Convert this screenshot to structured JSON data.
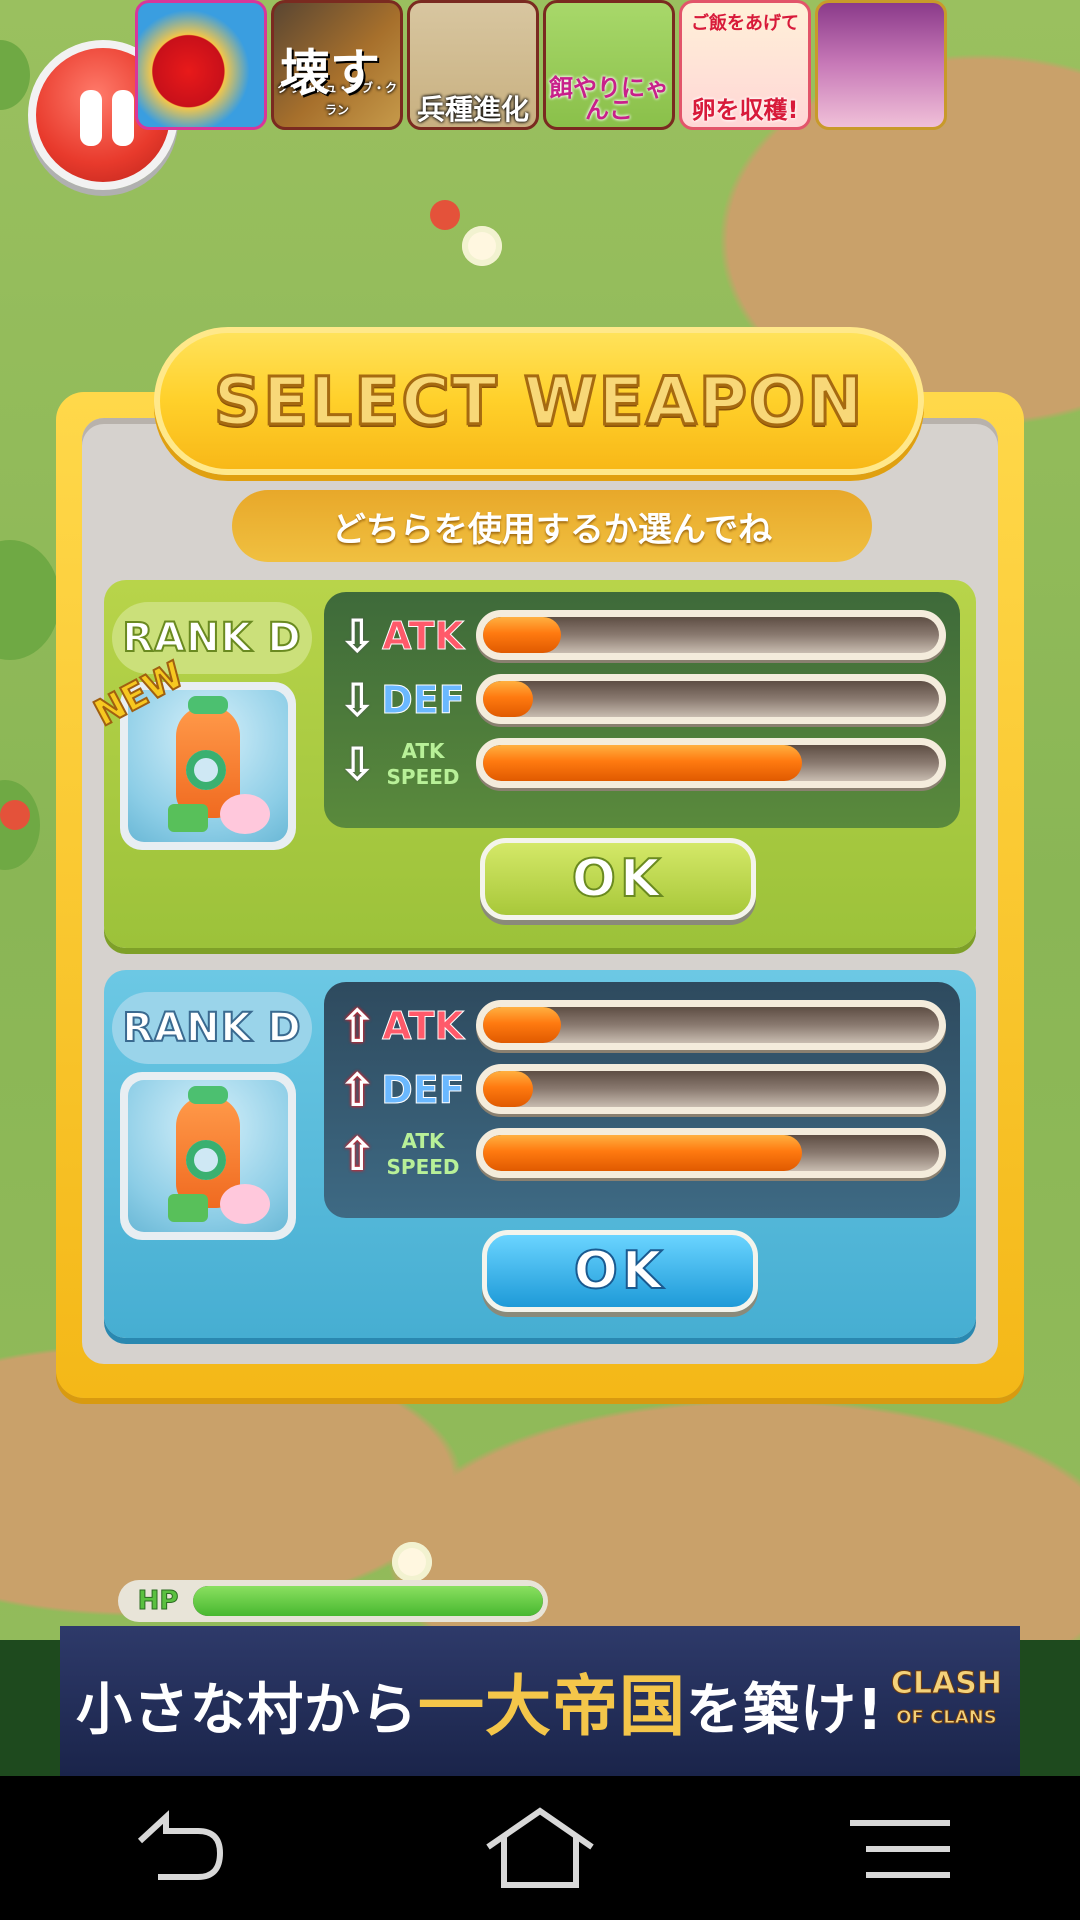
{
  "top_ads": [
    {
      "name": "candy-crush",
      "caption": ""
    },
    {
      "name": "clash-of-clans",
      "caption": "壊す",
      "footer": "クラッシュ・オブ・クラン"
    },
    {
      "name": "heishu-shinka",
      "caption": "兵種進化"
    },
    {
      "name": "esayari-nyanko",
      "caption": "餌やりにゃんこ"
    },
    {
      "name": "egg-collect",
      "top": "ご飯をあげて",
      "caption": "卵を収穫!"
    },
    {
      "name": "anime-girl",
      "caption": ""
    }
  ],
  "dialog": {
    "title": "SELECT WEAPON",
    "subtitle": "どちらを使用するか選んでね"
  },
  "weapons": [
    {
      "rank": "RANK D",
      "badge": "NEW",
      "stats": [
        {
          "label": "ATK",
          "arrow": "down",
          "value": 0.17
        },
        {
          "label": "DEF",
          "arrow": "down",
          "value": 0.11
        },
        {
          "label_line1": "ATK",
          "label_line2": "SPEED",
          "arrow": "down",
          "value": 0.7
        }
      ],
      "ok_label": "OK"
    },
    {
      "rank": "RANK D",
      "stats": [
        {
          "label": "ATK",
          "arrow": "up",
          "value": 0.17
        },
        {
          "label": "DEF",
          "arrow": "up",
          "value": 0.11
        },
        {
          "label_line1": "ATK",
          "label_line2": "SPEED",
          "arrow": "up",
          "value": 0.7
        }
      ],
      "ok_label": "OK"
    }
  ],
  "hp": {
    "label": "HP",
    "value": 1.0
  },
  "banner_ad": {
    "text_pre": "小さな村から",
    "text_highlight": "一大帝国",
    "text_post": "を築け!",
    "logo_line1": "CLASH",
    "logo_line2": "OF CLANS"
  },
  "colors": {
    "card_green": "#b8d44a",
    "card_blue": "#6cc8e4",
    "dialog_yellow": "#ffd84a",
    "bar_fill": "#ff7a10"
  },
  "icons": {
    "pause": "pause-icon",
    "back": "back-icon",
    "home": "home-icon",
    "menu": "menu-icon"
  }
}
